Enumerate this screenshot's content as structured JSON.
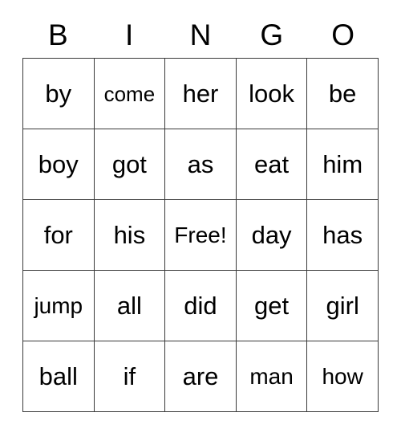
{
  "card": {
    "title": "BINGO",
    "header_letters": [
      "B",
      "I",
      "N",
      "G",
      "O"
    ],
    "free_space_label": "Free!",
    "colors": {
      "border": "#3a3a3a",
      "background": "#ffffff",
      "text": "#000000"
    },
    "grid": {
      "columns": 5,
      "rows": 5,
      "cells": [
        [
          {
            "text": "by",
            "size": "normal"
          },
          {
            "text": "come",
            "size": "small"
          },
          {
            "text": "her",
            "size": "normal"
          },
          {
            "text": "look",
            "size": "normal"
          },
          {
            "text": "be",
            "size": "normal"
          }
        ],
        [
          {
            "text": "boy",
            "size": "normal"
          },
          {
            "text": "got",
            "size": "normal"
          },
          {
            "text": "as",
            "size": "normal"
          },
          {
            "text": "eat",
            "size": "normal"
          },
          {
            "text": "him",
            "size": "normal"
          }
        ],
        [
          {
            "text": "for",
            "size": "normal"
          },
          {
            "text": "his",
            "size": "normal"
          },
          {
            "text": "Free!",
            "size": "medium"
          },
          {
            "text": "day",
            "size": "normal"
          },
          {
            "text": "has",
            "size": "normal"
          }
        ],
        [
          {
            "text": "jump",
            "size": "medium"
          },
          {
            "text": "all",
            "size": "normal"
          },
          {
            "text": "did",
            "size": "normal"
          },
          {
            "text": "get",
            "size": "normal"
          },
          {
            "text": "girl",
            "size": "normal"
          }
        ],
        [
          {
            "text": "ball",
            "size": "normal"
          },
          {
            "text": "if",
            "size": "normal"
          },
          {
            "text": "are",
            "size": "normal"
          },
          {
            "text": "man",
            "size": "medium"
          },
          {
            "text": "how",
            "size": "medium"
          }
        ]
      ]
    }
  }
}
